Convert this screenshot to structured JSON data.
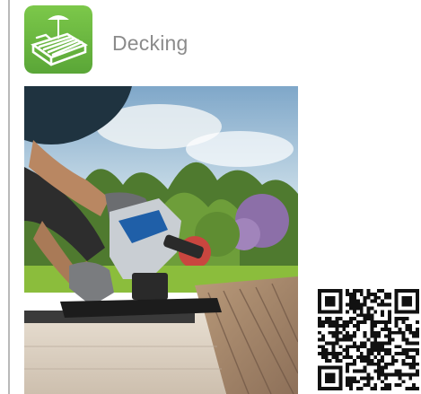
{
  "category": {
    "title": "Decking",
    "icon": "decking-icon",
    "icon_color": "#6dbb3f"
  },
  "photo": {
    "subject": "deck-installation-photo"
  },
  "qr_code": {
    "icon": "qr-code-icon"
  }
}
